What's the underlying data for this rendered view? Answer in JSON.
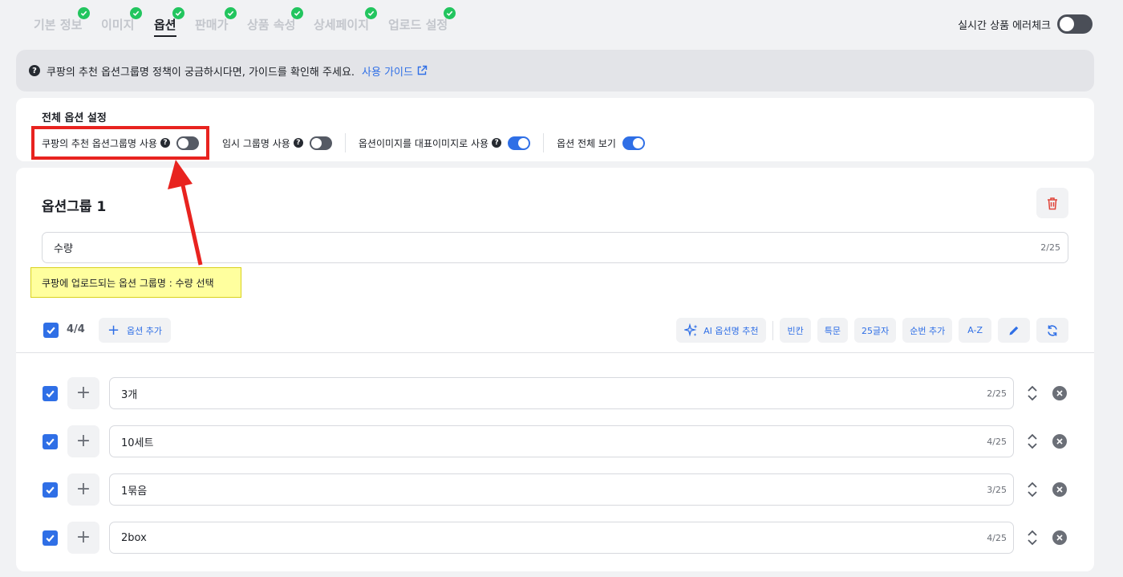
{
  "tabs": [
    {
      "label": "기본 정보",
      "done": true,
      "active": false
    },
    {
      "label": "이미지",
      "done": true,
      "active": false
    },
    {
      "label": "옵션",
      "done": true,
      "active": true
    },
    {
      "label": "판매가",
      "done": true,
      "active": false
    },
    {
      "label": "상품 속성",
      "done": true,
      "active": false
    },
    {
      "label": "상세페이지",
      "done": true,
      "active": false
    },
    {
      "label": "업로드 설정",
      "done": true,
      "active": false
    }
  ],
  "realtime_check": {
    "label": "실시간 상품 에러체크",
    "on": false
  },
  "banner": {
    "text": "쿠팡의 추천 옵션그룹명 정책이 궁금하시다면, 가이드를 확인해 주세요.",
    "link": "사용 가이드"
  },
  "global_options": {
    "title": "전체 옵션 설정",
    "items": [
      {
        "label": "쿠팡의 추천 옵션그룹명 사용",
        "help": true,
        "on": false
      },
      {
        "label": "임시 그룹명 사용",
        "help": true,
        "on": false
      },
      {
        "label": "옵션이미지를 대표이미지로 사용",
        "help": true,
        "on": true
      },
      {
        "label": "옵션 전체 보기",
        "help": false,
        "on": true
      }
    ]
  },
  "group": {
    "title": "옵션그룹 1",
    "name_value": "수량",
    "name_counter": "2/25"
  },
  "annotation": {
    "note": "쿠팡에 업로드되는 옵션 그룹명 : 수량 선택"
  },
  "toolbar": {
    "count": "4/4",
    "add_option": "옵션 추가",
    "ai_recommend": "AI 옵션명 추천",
    "blank": "빈칸",
    "special_chars": "특문",
    "chars25": "25글자",
    "add_sequence": "순번 추가",
    "az": "A-Z"
  },
  "options": [
    {
      "value": "3개",
      "counter": "2/25",
      "checked": true
    },
    {
      "value": "10세트",
      "counter": "4/25",
      "checked": true
    },
    {
      "value": "1묶음",
      "counter": "3/25",
      "checked": true
    },
    {
      "value": "2box",
      "counter": "4/25",
      "checked": true
    }
  ],
  "colors": {
    "accent": "#2f6fe6",
    "success": "#22c55e",
    "highlight_border": "#e8231f",
    "note_bg": "#ffff9e"
  },
  "icons": [
    "check-icon",
    "help-icon",
    "external-link-icon",
    "trash-icon",
    "plus-icon",
    "sparkle-icon",
    "pencil-icon",
    "refresh-icon",
    "reorder-icon",
    "close-circle-icon"
  ]
}
